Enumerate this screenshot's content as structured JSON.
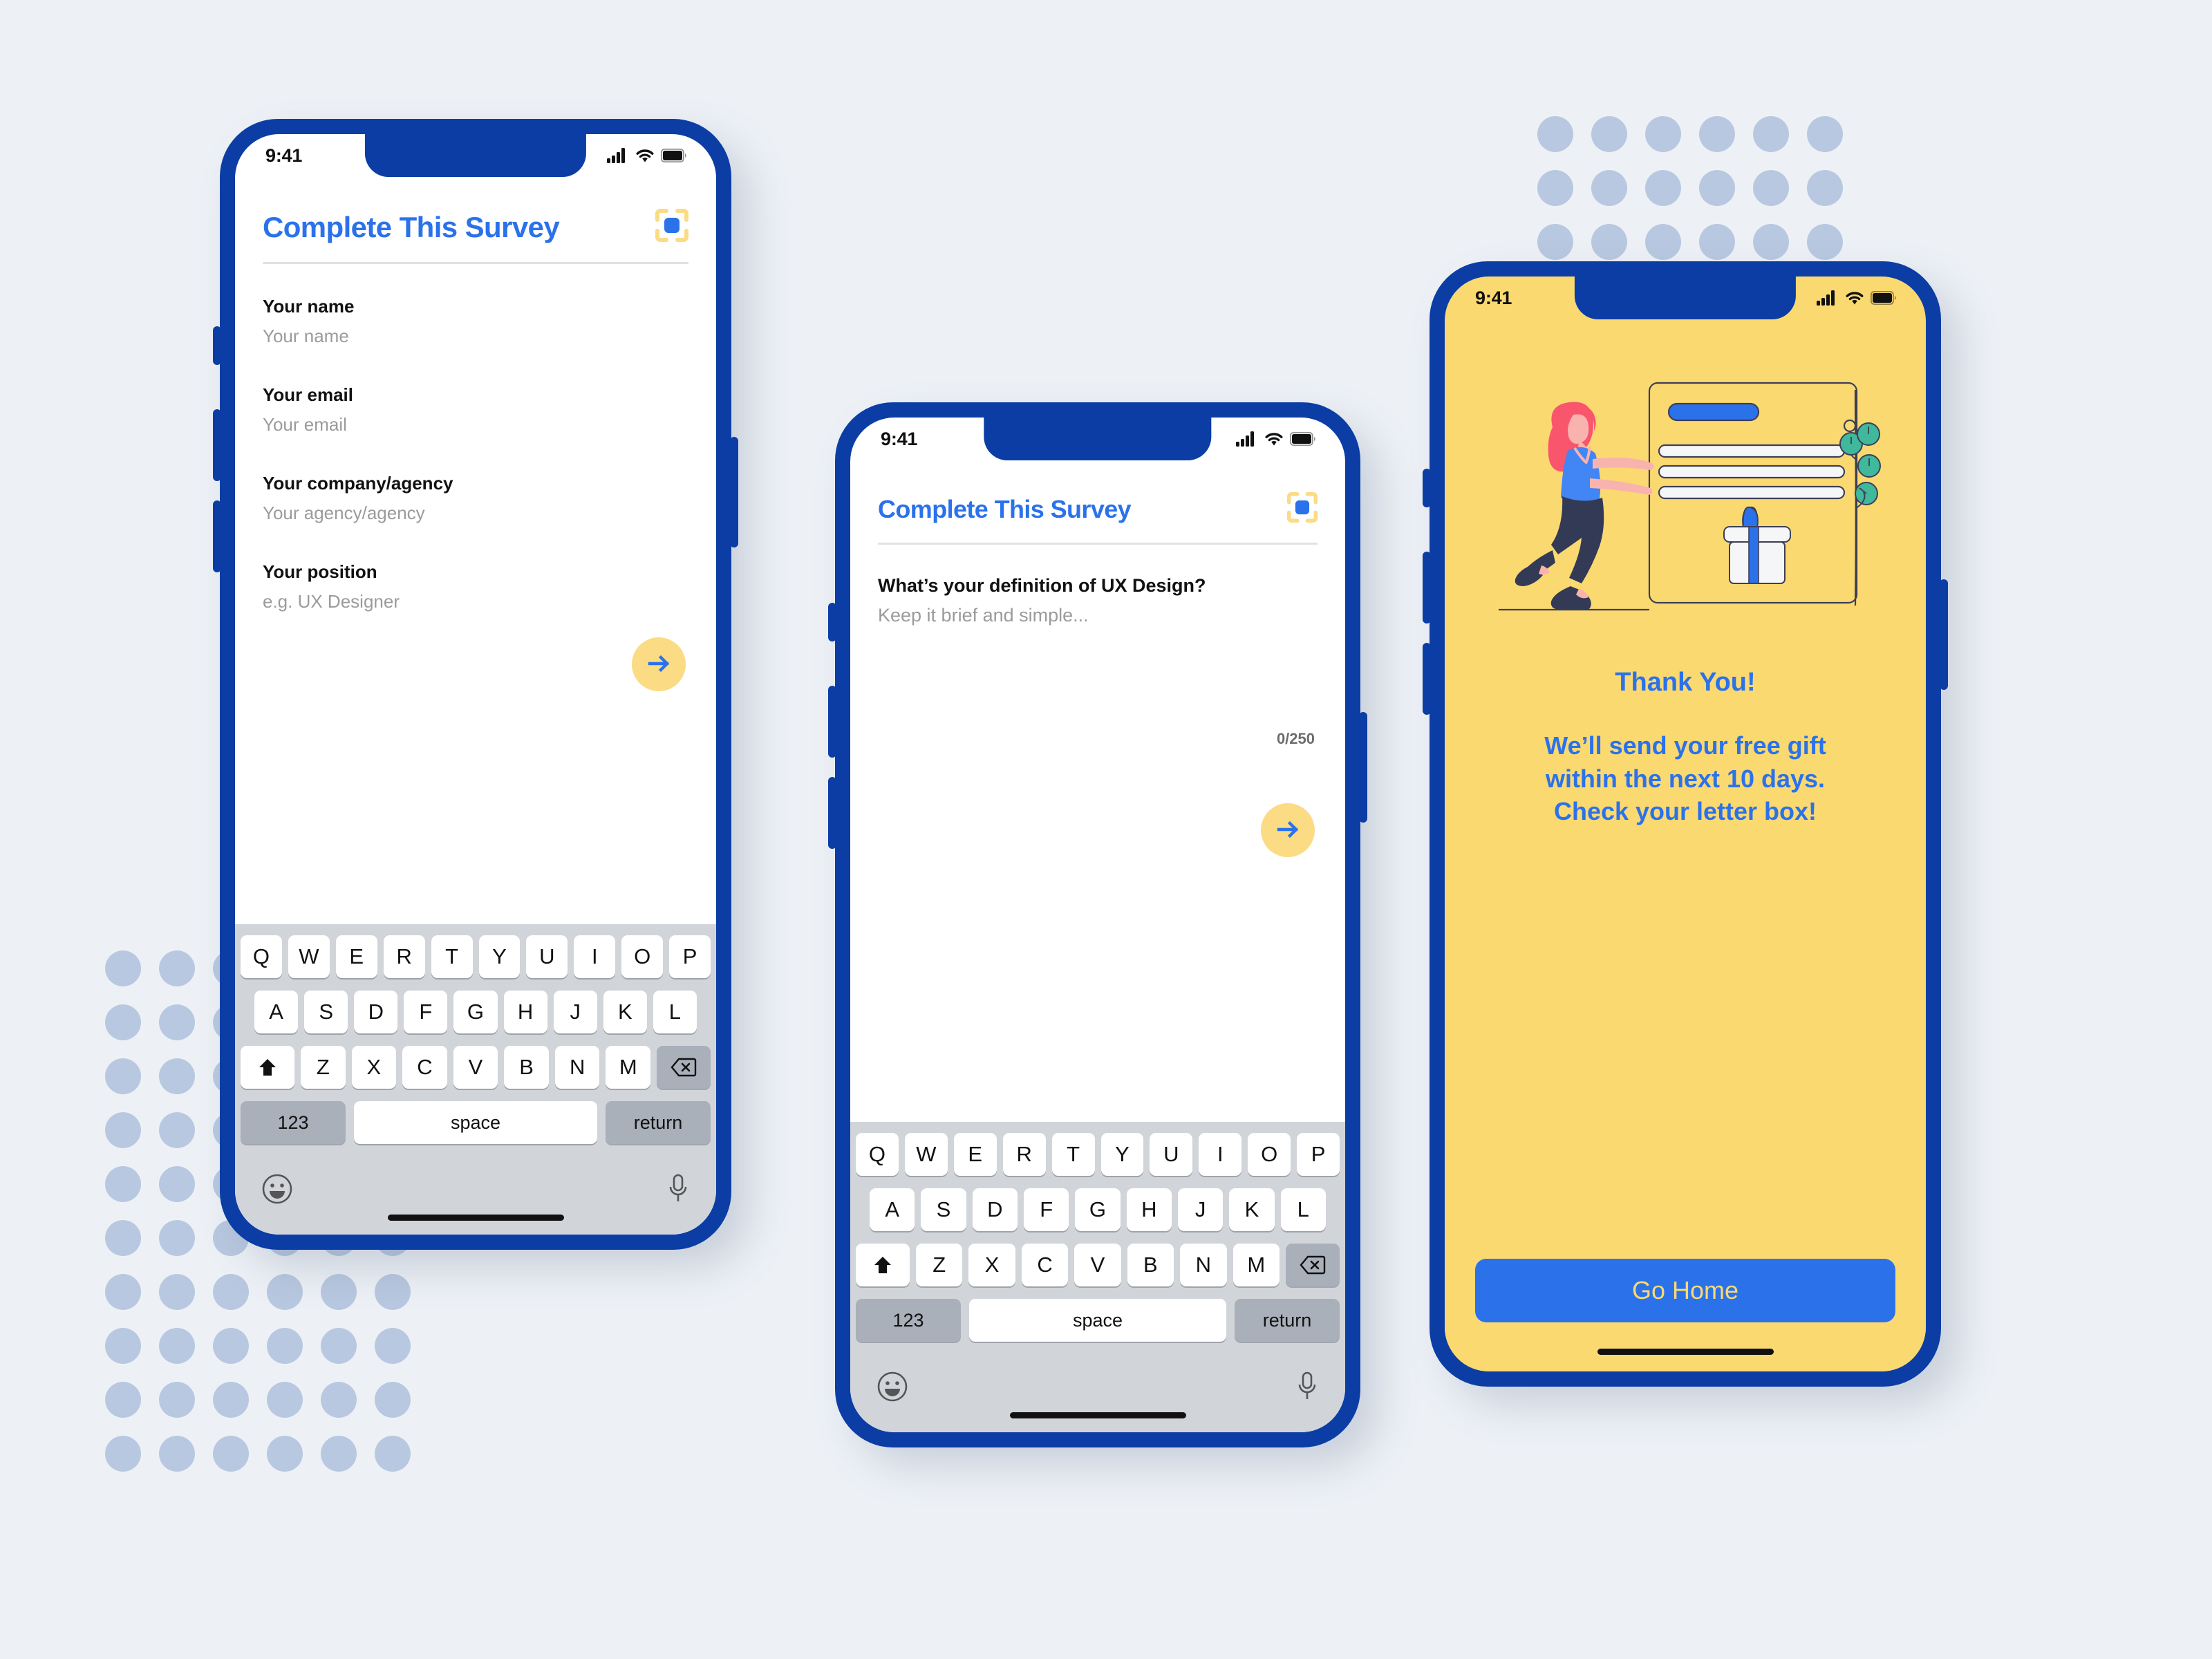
{
  "theme": {
    "page_bg": "#edf1f6",
    "frame_blue": "#0b3da5",
    "accent_blue": "#2b72ea",
    "accent_yellow": "#fbd971",
    "fab_yellow": "#fbdb84",
    "dot_blue": "#b8c8e0",
    "keyboard_bg": "#d1d5da",
    "placeholder_gray": "#9b9b9b"
  },
  "status_bar": {
    "time": "9:41",
    "cellular_icon": "cellular-signal-icon",
    "wifi_icon": "wifi-icon",
    "battery_icon": "battery-full-icon"
  },
  "keyboard": {
    "row1": [
      "Q",
      "W",
      "E",
      "R",
      "T",
      "Y",
      "U",
      "I",
      "O",
      "P"
    ],
    "row2": [
      "A",
      "S",
      "D",
      "F",
      "G",
      "H",
      "J",
      "K",
      "L"
    ],
    "row3": [
      "Z",
      "X",
      "C",
      "V",
      "B",
      "N",
      "M"
    ],
    "shift_icon": "shift-arrow-icon",
    "delete_icon": "backspace-icon",
    "numbers_label": "123",
    "space_label": "space",
    "return_label": "return",
    "emoji_icon": "emoji-smiley-icon",
    "dictation_icon": "microphone-icon"
  },
  "screen_one": {
    "title": "Complete This Survey",
    "scan_icon": "qr-scan-icon",
    "fields": [
      {
        "label": "Your name",
        "placeholder": "Your name"
      },
      {
        "label": "Your email",
        "placeholder": "Your email"
      },
      {
        "label": "Your company/agency",
        "placeholder": "Your agency/agency"
      },
      {
        "label": "Your position",
        "placeholder": "e.g. UX Designer"
      }
    ],
    "next_icon": "arrow-right-icon"
  },
  "screen_two": {
    "title": "Complete This Survey",
    "scan_icon": "qr-scan-icon",
    "question_label": "What’s your definition of UX Design?",
    "answer_placeholder": "Keep it brief and simple...",
    "char_counter": "0/250",
    "next_icon": "arrow-right-icon"
  },
  "screen_three": {
    "illustration": "woman-reaching-for-gift-illustration",
    "title": "Thank You!",
    "body_line_1": "We’ll send your free gift",
    "body_line_2": "within the next 10 days.",
    "body_line_3": "Check your letter box!",
    "cta_label": "Go Home"
  }
}
